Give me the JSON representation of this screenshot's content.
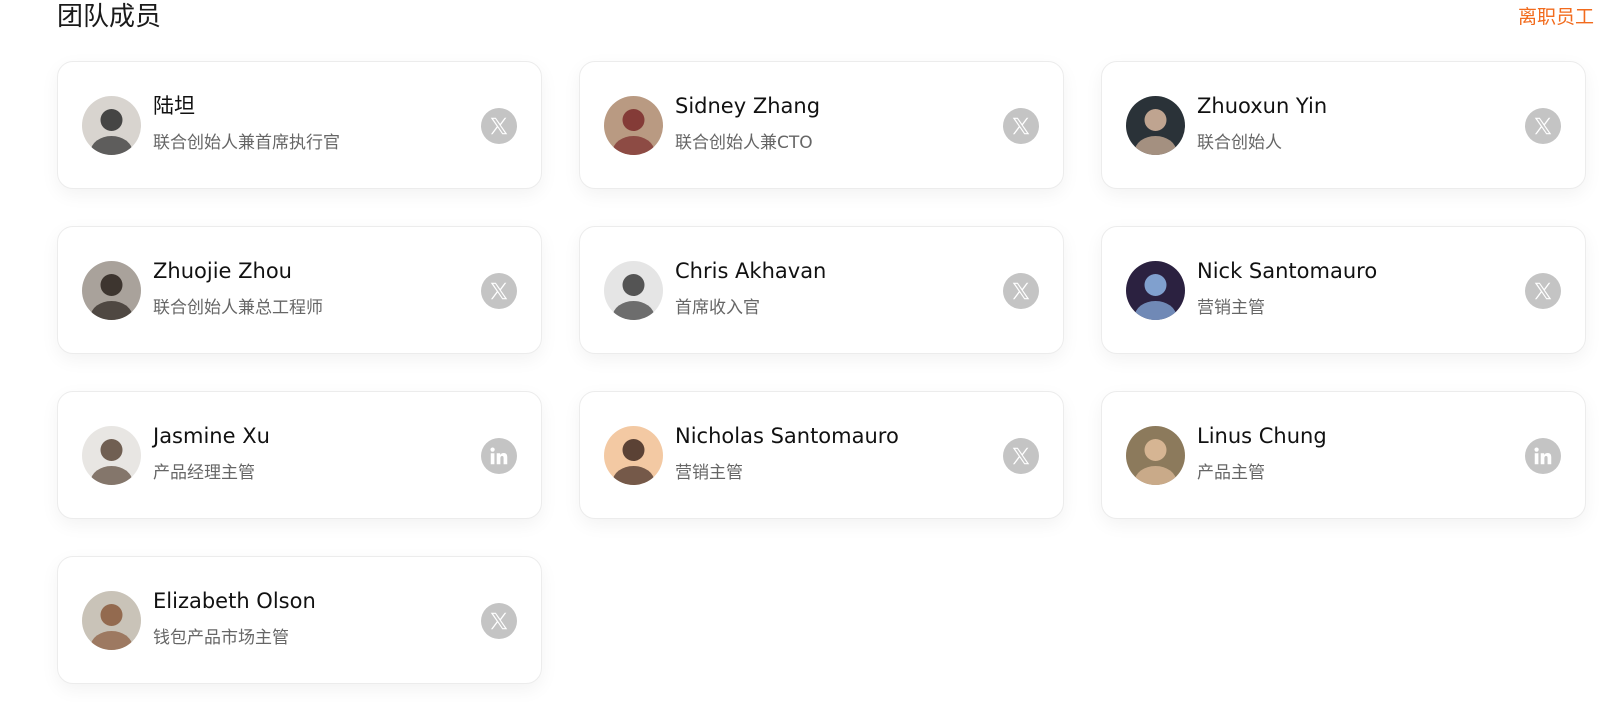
{
  "section": {
    "title": "团队成员",
    "former_link": "离职员工"
  },
  "colors": {
    "accent": "#f26b1d",
    "icon_bg": "#c4c4c4"
  },
  "members": [
    {
      "name": "陆坦",
      "role": "联合创始人兼首席执行官",
      "social": "x-icon",
      "avatar_bg": "#d8d4cf",
      "avatar_fg": "#2b2b2b"
    },
    {
      "name": "Sidney Zhang",
      "role": "联合创始人兼CTO",
      "social": "x-icon",
      "avatar_bg": "#b99a82",
      "avatar_fg": "#7a2a2a"
    },
    {
      "name": "Zhuoxun Yin",
      "role": "联合创始人",
      "social": "x-icon",
      "avatar_bg": "#2a3238",
      "avatar_fg": "#d9b8a0"
    },
    {
      "name": "Zhuojie Zhou",
      "role": "联合创始人兼总工程师",
      "social": "x-icon",
      "avatar_bg": "#a9a29b",
      "avatar_fg": "#2a221c"
    },
    {
      "name": "Chris Akhavan",
      "role": "首席收入官",
      "social": "x-icon",
      "avatar_bg": "#e5e5e5",
      "avatar_fg": "#3b3b3b"
    },
    {
      "name": "Nick Santomauro",
      "role": "营销主管",
      "social": "x-icon",
      "avatar_bg": "#2b2140",
      "avatar_fg": "#8fb6e8"
    },
    {
      "name": "Jasmine Xu",
      "role": "产品经理主管",
      "social": "linkedin-icon",
      "avatar_bg": "#e8e6e3",
      "avatar_fg": "#5a4638"
    },
    {
      "name": "Nicholas Santomauro",
      "role": "营销主管",
      "social": "x-icon",
      "avatar_bg": "#f3c9a3",
      "avatar_fg": "#3f2a22"
    },
    {
      "name": "Linus Chung",
      "role": "产品主管",
      "social": "linkedin-icon",
      "avatar_bg": "#8c7a5c",
      "avatar_fg": "#e3bf9c"
    },
    {
      "name": "Elizabeth Olson",
      "role": "钱包产品市场主管",
      "social": "x-icon",
      "avatar_bg": "#c9c3b8",
      "avatar_fg": "#8a5a3c"
    }
  ]
}
